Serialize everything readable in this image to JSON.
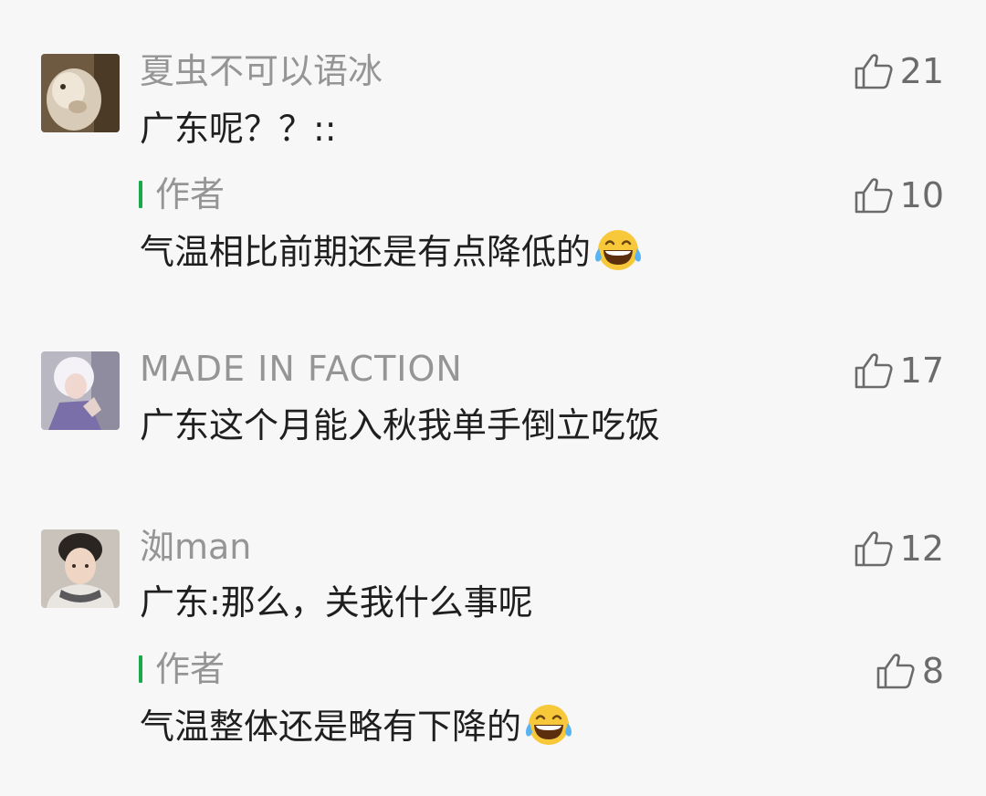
{
  "comments": [
    {
      "username": "夏虫不可以语冰",
      "text": "广东呢？？::",
      "likes": "21",
      "reply": {
        "author_label": "作者",
        "text": "气温相比前期还是有点降低的",
        "emoji": "laughing-tears-emoji",
        "likes": "10"
      }
    },
    {
      "username": "MADE IN FACTION",
      "text": "广东这个月能入秋我单手倒立吃饭",
      "likes": "17"
    },
    {
      "username": "洳man",
      "text": "广东:那么，关我什么事呢",
      "likes": "12",
      "reply": {
        "author_label": "作者",
        "text": "气温整体还是略有下降的",
        "emoji": "laughing-tears-emoji",
        "likes": "8"
      }
    }
  ],
  "colors": {
    "background": "#f7f7f7",
    "username": "#959595",
    "text": "#1f1f1f",
    "author_bar": "#19a94b",
    "like": "#6b6b6b"
  }
}
